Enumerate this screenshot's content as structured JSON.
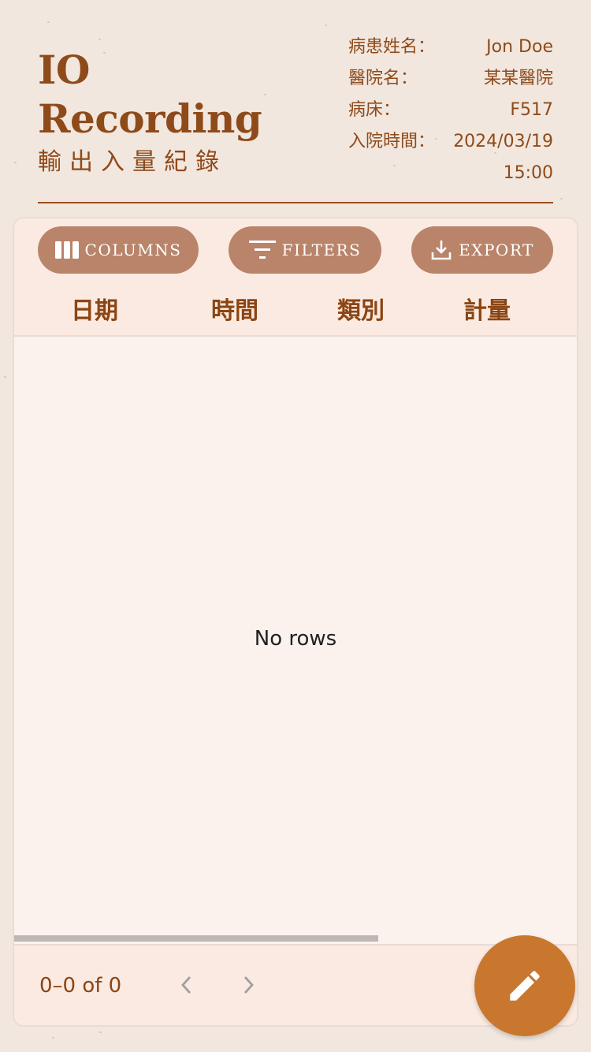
{
  "header": {
    "title_en_line1": "IO",
    "title_en_line2": "Recording",
    "title_zh": "輸出入量紀錄"
  },
  "patient_info": {
    "name_label": "病患姓名：",
    "name_value": "Jon Doe",
    "hospital_label": "醫院名：",
    "hospital_value": "某某醫院",
    "bed_label": "病床：",
    "bed_value": "F517",
    "admission_label": "入院時間：",
    "admission_date": "2024/03/19",
    "admission_time": "15:00"
  },
  "toolbar": {
    "columns_label": "COLUMNS",
    "filters_label": "FILTERS",
    "export_label": "EXPORT"
  },
  "table": {
    "columns": [
      "日期",
      "時間",
      "類別",
      "計量"
    ],
    "empty_text": "No rows"
  },
  "footer": {
    "pagination_text": "0–0 of 0"
  },
  "icons": {
    "columns": "view-column-icon",
    "filters": "filter-list-icon",
    "export": "download-icon",
    "prev": "chevron-left-icon",
    "next": "chevron-right-icon",
    "fab": "edit-pencil-icon"
  },
  "colors": {
    "background": "#f1e7de",
    "accent_text": "#8b4513",
    "toolbar_button": "#b9846a",
    "fab": "#c9772f"
  }
}
